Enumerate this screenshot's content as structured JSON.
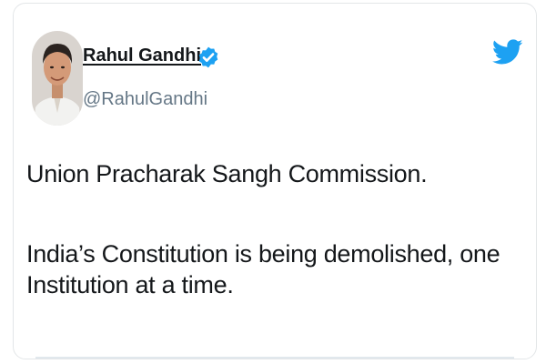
{
  "tweet": {
    "author": {
      "display_name": "Rahul Gandhi",
      "handle": "@RahulGandhi",
      "verified": true,
      "avatar_icon": "profile-photo"
    },
    "paragraphs": [
      "Union Pracharak Sangh Commission.",
      "India’s Constitution is being demolished, one Institution at a time."
    ]
  },
  "icons": {
    "brand": "twitter-bird-icon",
    "verified": "verified-badge-icon"
  },
  "colors": {
    "brand_blue": "#1da1f2",
    "text": "#14171a",
    "secondary_text": "#657786",
    "border": "#e3e6e8"
  }
}
